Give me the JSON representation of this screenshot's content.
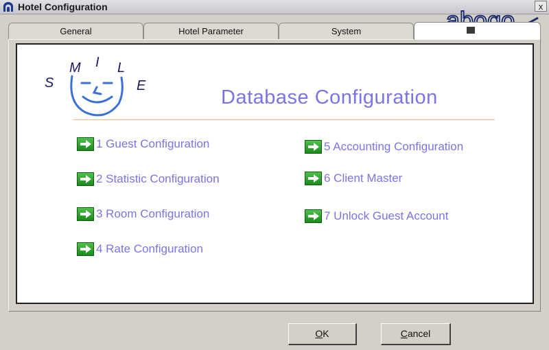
{
  "window": {
    "title": "Hotel Configuration",
    "close_label": "x"
  },
  "tabs": [
    {
      "label": "General"
    },
    {
      "label": "Hotel Parameter"
    },
    {
      "label": "System"
    },
    {
      "label": ""
    }
  ],
  "logo": {
    "letters": [
      "S",
      "M",
      "I",
      "L",
      "E"
    ]
  },
  "watermark": "abogo",
  "heading": "Database Configuration",
  "links": [
    {
      "label": "1 Guest Configuration"
    },
    {
      "label": "2 Statistic Configuration"
    },
    {
      "label": "3 Room Configuration"
    },
    {
      "label": "4 Rate Configuration"
    },
    {
      "label": "5 Accounting Configuration"
    },
    {
      "label": "6 Client Master"
    },
    {
      "label": "7 Unlock Guest Account"
    }
  ],
  "buttons": {
    "ok": {
      "accel": "O",
      "rest": "K"
    },
    "cancel": {
      "accel": "C",
      "rest": "ancel"
    }
  },
  "colors": {
    "link": "#7a74e6",
    "heading": "#7b73e6",
    "arrow": "#2aa12a",
    "divider": "#f2b980"
  }
}
